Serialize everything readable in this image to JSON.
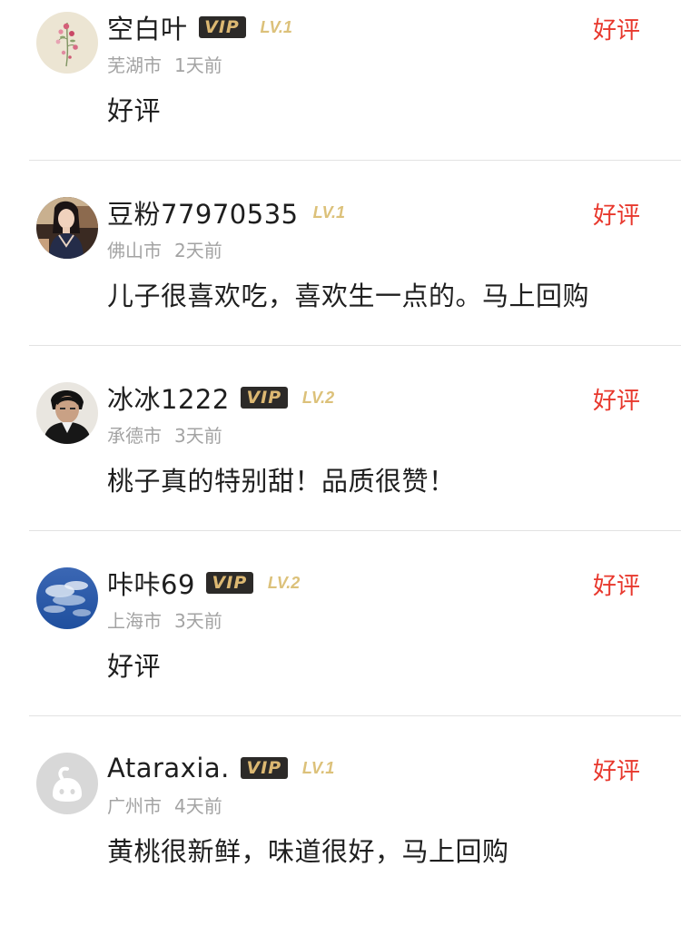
{
  "reviews": [
    {
      "username": "空白叶",
      "vip": "VIP",
      "level": "LV.1",
      "city": "芜湖市",
      "time": "1天前",
      "rating": "好评",
      "comment": "好评",
      "avatar": "flower-avatar-icon"
    },
    {
      "username": "豆粉77970535",
      "vip": "",
      "level": "LV.1",
      "city": "佛山市",
      "time": "2天前",
      "rating": "好评",
      "comment": "儿子很喜欢吃，喜欢生一点的。马上回购",
      "avatar": "woman-portrait-avatar-icon"
    },
    {
      "username": "冰冰1222",
      "vip": "VIP",
      "level": "LV.2",
      "city": "承德市",
      "time": "3天前",
      "rating": "好评",
      "comment": "桃子真的特别甜！品质很赞！",
      "avatar": "man-portrait-avatar-icon"
    },
    {
      "username": "咔咔69",
      "vip": "VIP",
      "level": "LV.2",
      "city": "上海市",
      "time": "3天前",
      "rating": "好评",
      "comment": "好评",
      "avatar": "sky-avatar-icon"
    },
    {
      "username": "Ataraxia.",
      "vip": "VIP",
      "level": "LV.1",
      "city": "广州市",
      "time": "4天前",
      "rating": "好评",
      "comment": "黄桃很新鲜，味道很好，马上回购",
      "avatar": "default-avatar-icon"
    }
  ],
  "colors": {
    "rating_red": "#e8382d",
    "vip_badge_bg": "#2c2a28",
    "vip_badge_gold": "#dcb872",
    "level_gold": "#dcc17a",
    "meta_gray": "#a3a3a3",
    "divider": "#e2e2e2"
  }
}
